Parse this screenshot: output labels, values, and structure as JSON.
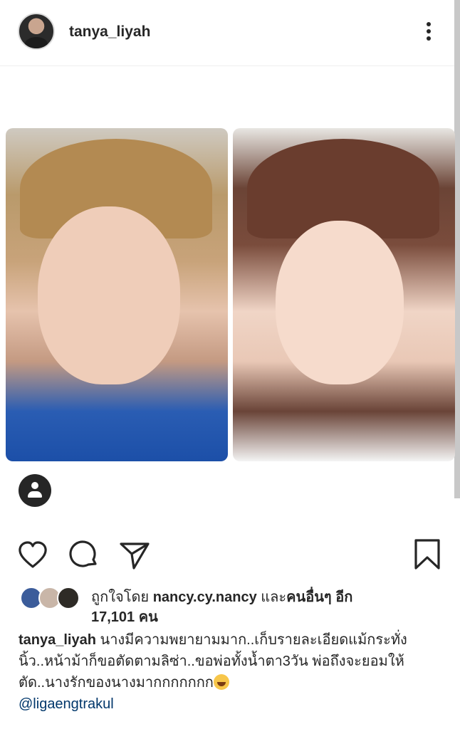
{
  "post": {
    "username": "tanya_liyah",
    "more_icon": "more-vertical-icon"
  },
  "media": {
    "left_alt": "",
    "right_alt": ""
  },
  "actions": {
    "like_icon": "heart-icon",
    "comment_icon": "comment-icon",
    "share_icon": "send-icon",
    "save_icon": "bookmark-icon",
    "tag_icon": "user-tag-icon"
  },
  "likes": {
    "prefix": "ถูกใจโดย",
    "user": "nancy.cy.nancy",
    "middle": "และ",
    "others": "คนอื่นๆ อีก",
    "count": "17,101 คน"
  },
  "caption": {
    "username": "tanya_liyah",
    "text": "นางมีความพยายามมาก..เก็บรายละเอียดแม้กระทั่งนิ้ว..หน้าม้าก็ขอตัดตามลิซ่า..ขอพ่อทั้งน้ำตา3วัน พ่อถึงจะยอมให้ตัด..นางรักของนางมากกกกกกก",
    "emoji": "grinning-sweat-emoji",
    "mention": "@ligaengtrakul"
  },
  "colors": {
    "text": "#262626",
    "mention": "#00376b",
    "divider": "#efefef"
  }
}
